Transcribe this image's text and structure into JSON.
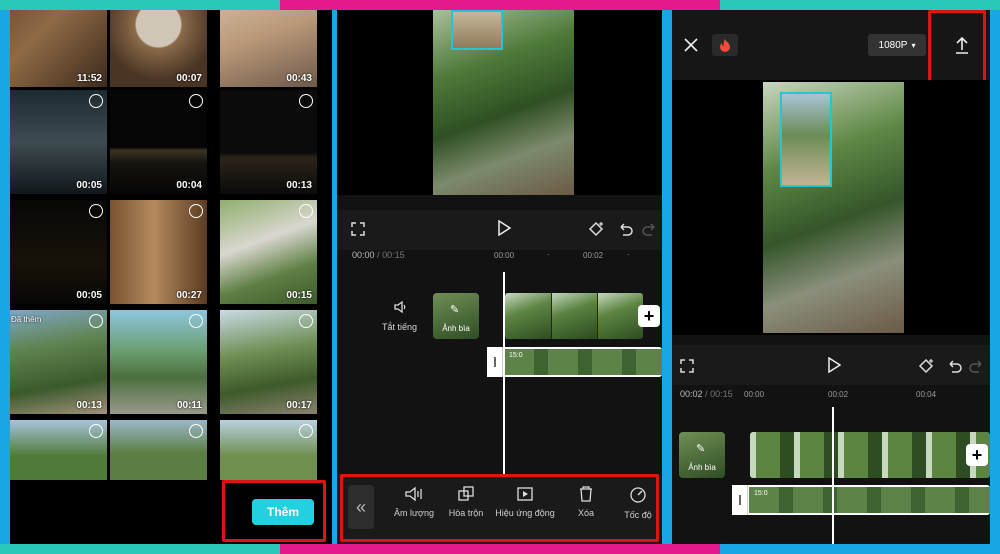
{
  "gallery": {
    "add_button": "Thêm",
    "added_badge": "Đã thêm",
    "durations": [
      "11:52",
      "00:07",
      "00:43",
      "00:05",
      "00:04",
      "00:13",
      "00:05",
      "00:27",
      "00:15",
      "00:13",
      "00:11",
      "00:17"
    ]
  },
  "editor": {
    "time_current": "00:00",
    "time_sep": "/",
    "time_total": "00:15",
    "tick_a": "00:00",
    "tick_b": "00:02",
    "mute_label": "Tắt tiếng",
    "cover_label": "Ảnh bìa",
    "clip_label": "15:0",
    "tools": [
      {
        "label": "Âm lượng",
        "icon": "volume-icon"
      },
      {
        "label": "Hòa trộn",
        "icon": "blend-icon"
      },
      {
        "label": "Hiệu ứng động",
        "icon": "animation-icon"
      },
      {
        "label": "Xóa",
        "icon": "trash-icon"
      },
      {
        "label": "Tốc độ",
        "icon": "speed-icon"
      }
    ]
  },
  "export": {
    "resolution": "1080P",
    "time_current": "00:02",
    "time_sep": "/",
    "time_total": "00:15",
    "tick_a": "00:00",
    "tick_b": "00:02",
    "tick_c": "00:04",
    "cover_label": "Ảnh bìa",
    "clip_label": "15:0"
  },
  "colors": {
    "accent_cyan": "#22d0df",
    "highlight_red": "#e01313",
    "frame_teal": "#28c9b8",
    "frame_pink": "#e4198b",
    "frame_blue": "#1aa6e4"
  }
}
